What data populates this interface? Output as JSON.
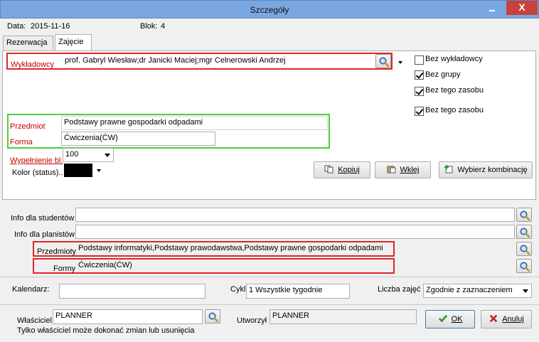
{
  "window": {
    "title": "Szczegóły",
    "close_glyph": "X"
  },
  "header": {
    "date_label": "Data:",
    "date_value": "2015-11-16",
    "block_label": "Blok:",
    "block_value": "4"
  },
  "tabs": [
    {
      "label": "Rezerwacja"
    },
    {
      "label": "Zajęcie"
    }
  ],
  "lecturers": {
    "label": "Wykładowcy",
    "value": "prof. Gabryl Wiesław;dr Janicki Maciej;mgr Celnerowski Andrzej"
  },
  "checkboxes": [
    {
      "label": "Bez wykładowcy",
      "checked": false
    },
    {
      "label": "Bez grupy",
      "checked": true
    },
    {
      "label": "Bez tego zasobu",
      "checked": true
    },
    {
      "label": "Bez tego zasobu",
      "checked": true
    }
  ],
  "subject": {
    "label": "Przedmiot",
    "value": "Podstawy prawne gospodarki odpadami"
  },
  "form": {
    "label": "Forma",
    "value": "Ćwiczenia(ĆW)"
  },
  "fill": {
    "label": "Wypełnienie bl.",
    "value": "100"
  },
  "color": {
    "label": "Kolor (status)..",
    "swatch": "#000000"
  },
  "actions": {
    "copy": "Kopiuj",
    "paste": "Wklej",
    "choose": "Wybierz kombinację"
  },
  "info": {
    "students_label": "Info dla studentów",
    "students_value": "",
    "planners_label": "Info dla planistów",
    "planners_value": "",
    "subjects_label": "Przedmioty",
    "subjects_value": "Podstawy informatyki,Podstawy prawodawstwa,Podstawy prawne gospodarki odpadami",
    "forms_label": "Formy",
    "forms_value": "Ćwiczenia(ĆW)"
  },
  "calendar": {
    "label": "Kalendarz:",
    "value": ""
  },
  "cycle": {
    "label": "Cykl",
    "value": "1 Wszystkie tygodnie"
  },
  "classes_count": {
    "label": "Liczba zajęć",
    "value": "Zgodnie z zaznaczeniem"
  },
  "owner": {
    "label": "Właściciel",
    "value": "PLANNER",
    "note": "Tylko właściciel może dokonać zmian lub usunięcia"
  },
  "created": {
    "label": "Utworzył",
    "value": "PLANNER"
  },
  "buttons": {
    "ok": "OK",
    "cancel": "Anuluj"
  },
  "colors": {
    "title_bar": "#7ba7e1",
    "close": "#c7423a",
    "highlight_red": "#e1262a",
    "highlight_green": "#4ccf3a",
    "label_red": "#c00000"
  }
}
